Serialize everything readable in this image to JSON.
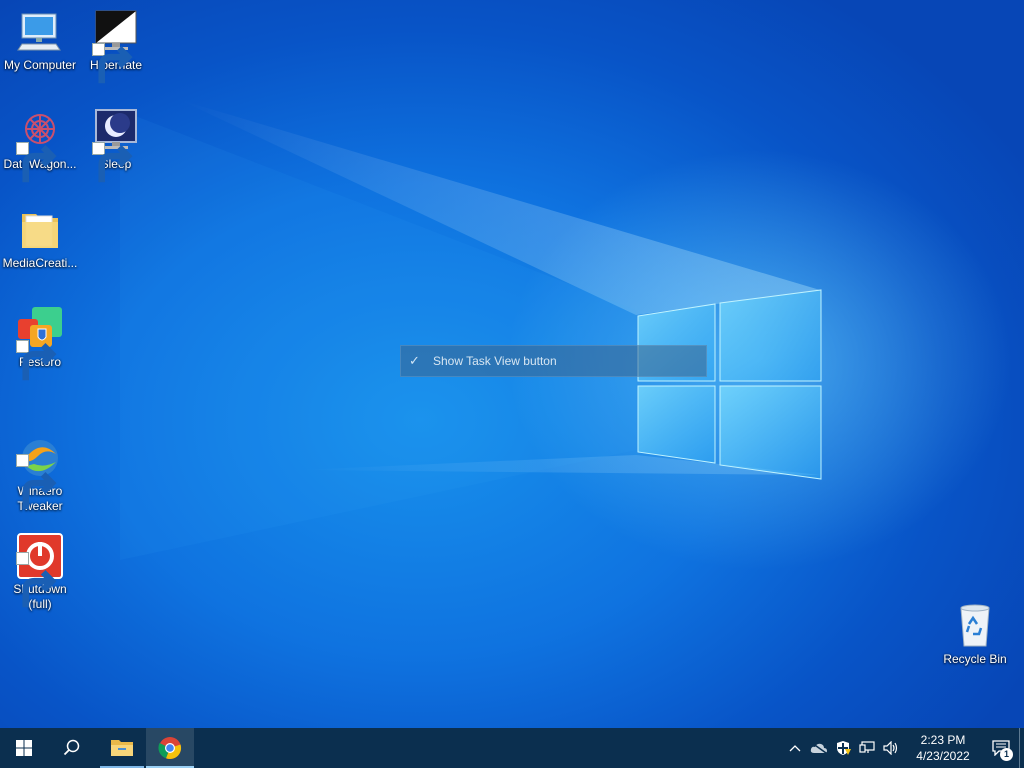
{
  "desktop": {
    "icons": [
      {
        "label": "My Computer",
        "icon": "computer-icon"
      },
      {
        "label": "Hibernate",
        "icon": "hibernate-icon"
      },
      {
        "label": "DataWagon...",
        "icon": "datawagon-icon"
      },
      {
        "label": "Sleep",
        "icon": "sleep-icon"
      },
      {
        "label": "MediaCreati...",
        "icon": "folder-icon"
      },
      {
        "label": "Restoro",
        "icon": "restoro-icon"
      },
      {
        "label": "Winaero\nTweaker",
        "icon": "winaero-tweaker-icon"
      },
      {
        "label": "Shutdown\n(full)",
        "icon": "shutdown-icon"
      },
      {
        "label": "Recycle Bin",
        "icon": "recycle-bin-icon"
      }
    ]
  },
  "context_menu": {
    "item_label": "Show Task View button",
    "item_checked": true
  },
  "taskbar": {
    "clock_time": "2:23 PM",
    "clock_date": "4/23/2022",
    "notification_count": "1",
    "accent_color": "#7fb8e8",
    "background_color": "#0b2f4f"
  }
}
